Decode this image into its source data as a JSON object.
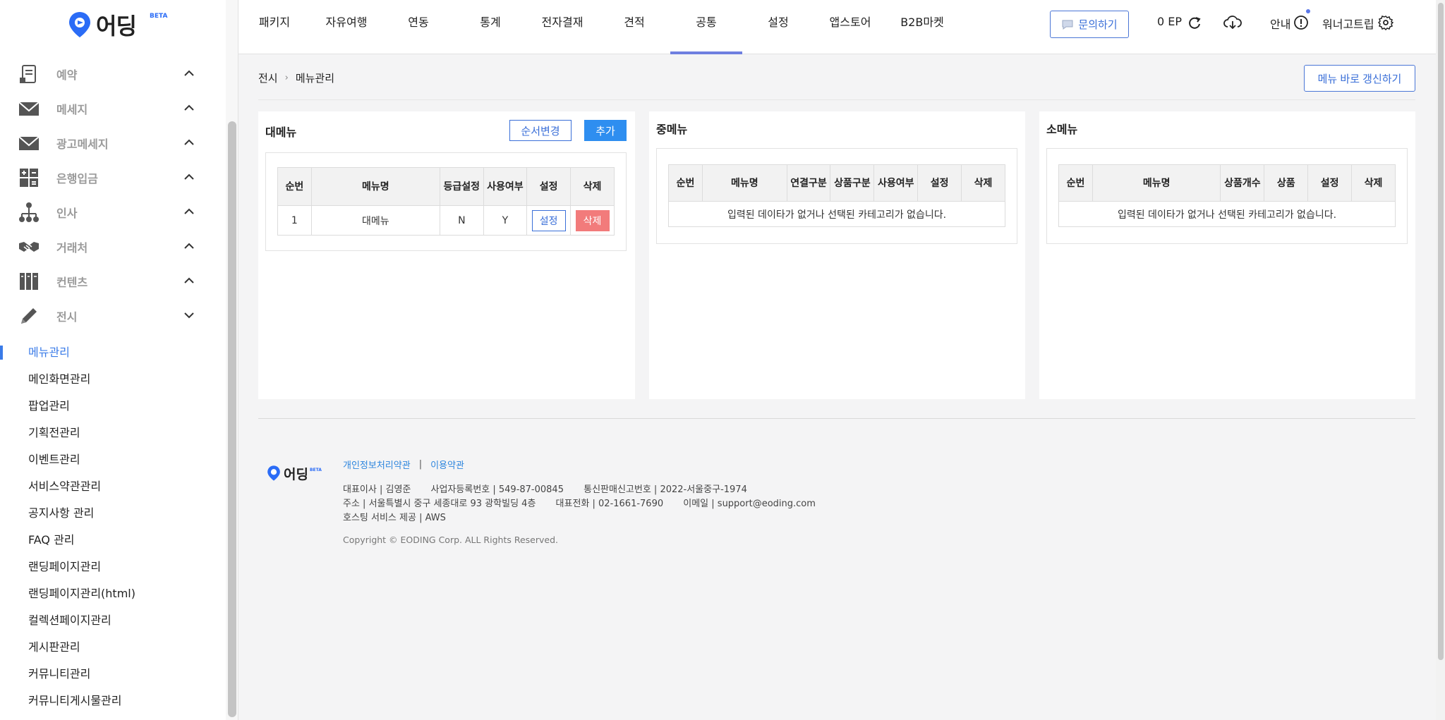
{
  "logo": {
    "word": "어딩",
    "beta": "BETA"
  },
  "sidebar": {
    "menu": [
      {
        "label": "예약",
        "icon": "calendar-doc-icon"
      },
      {
        "label": "메세지",
        "icon": "envelope-icon"
      },
      {
        "label": "광고메세지",
        "icon": "envelope-icon"
      },
      {
        "label": "은행입금",
        "icon": "calculator-icon"
      },
      {
        "label": "인사",
        "icon": "org-chart-icon"
      },
      {
        "label": "거래처",
        "icon": "handshake-icon"
      },
      {
        "label": "컨텐츠",
        "icon": "books-icon"
      },
      {
        "label": "전시",
        "icon": "pencil-icon"
      }
    ],
    "submenu": [
      "메뉴관리",
      "메인화면관리",
      "팝업관리",
      "기획전관리",
      "이벤트관리",
      "서비스약관관리",
      "공지사항 관리",
      "FAQ 관리",
      "랜딩페이지관리",
      "랜딩페이지관리(html)",
      "컬렉션페이지관리",
      "게시판관리",
      "커뮤니티관리",
      "커뮤니티게시물관리"
    ],
    "active_submenu": "메뉴관리"
  },
  "header": {
    "tabs": [
      "패키지",
      "자유여행",
      "연동",
      "통계",
      "전자결재",
      "견적",
      "공통",
      "설정",
      "앱스토어",
      "B2B마켓"
    ],
    "active_tab": "공통",
    "inquiry_label": "문의하기",
    "ep_label": "0 EP",
    "notice_label": "안내",
    "user_label": "워너고트립"
  },
  "breadcrumb": {
    "parent": "전시",
    "current": "메뉴관리"
  },
  "refresh_menu_label": "메뉴 바로 갱신하기",
  "panels": {
    "major": {
      "title": "대메뉴",
      "order_label": "순서변경",
      "add_label": "추가",
      "columns": [
        "순번",
        "메뉴명",
        "등급설정",
        "사용여부",
        "설정",
        "삭제"
      ],
      "rows": [
        {
          "no": "1",
          "name": "대메뉴",
          "grade": "N",
          "use": "Y",
          "set": "설정",
          "del": "삭제"
        }
      ]
    },
    "middle": {
      "title": "중메뉴",
      "columns": [
        "순번",
        "메뉴명",
        "연결구분",
        "상품구분",
        "사용여부",
        "설정",
        "삭제"
      ],
      "empty": "입력된 데이타가 없거나 선택된 카테고리가 없습니다."
    },
    "minor": {
      "title": "소메뉴",
      "columns": [
        "순번",
        "메뉴명",
        "상품개수",
        "상품",
        "설정",
        "삭제"
      ],
      "empty": "입력된 데이타가 없거나 선택된 카테고리가 없습니다."
    }
  },
  "footer": {
    "privacy_link": "개인정보처리약관",
    "separator": "|",
    "terms_link": "이용약관",
    "ceo": "대표이사 | 김영준",
    "biz_no": "사업자등록번호 | 549-87-00845",
    "mail_order_no": "통신판매신고번호 | 2022-서울중구-1974",
    "address": "주소 | 서울특별시 중구 세종대로 93 광학빌딩 4층",
    "phone": "대표전화 | 02-1661-7690",
    "email": "이메일 | support@eoding.com",
    "hosting": "호스팅 서비스 제공 | AWS",
    "copyright": "Copyright © EODING Corp. ALL Rights Reserved."
  },
  "colors": {
    "accent": "#3a6fd8",
    "add_button": "#2e8ef0",
    "delete_button": "#f27b7b",
    "active_tab_bar": "#6e7fe0"
  }
}
